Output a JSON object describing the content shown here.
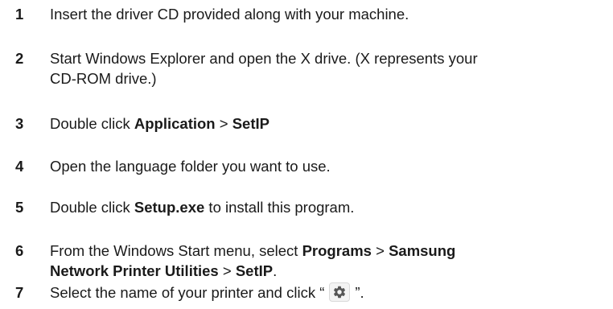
{
  "steps": [
    {
      "number": "1",
      "text_1": "Insert the driver CD provided along with your machine."
    },
    {
      "number": "2",
      "line_1": "Start Windows Explorer and open the X drive. (X represents your",
      "line_2": "CD-ROM drive.)"
    },
    {
      "number": "3",
      "text_1": "Double click ",
      "bold_1": "Application",
      "text_2": " > ",
      "bold_2": "SetIP"
    },
    {
      "number": "4",
      "text_1": "Open the language folder you want to use."
    },
    {
      "number": "5",
      "text_1": "Double click ",
      "bold_1": "Setup.exe",
      "text_2": " to install this program."
    },
    {
      "number": "6",
      "text_1": "From the Windows Start menu, select ",
      "bold_1": "Programs",
      "text_2": " > ",
      "bold_2": "Samsung",
      "bold_3": "Network Printer Utilities",
      "text_3": " > ",
      "bold_4": "SetIP",
      "text_4": "."
    },
    {
      "number": "7",
      "text_1": "Select the name of your printer and click “",
      "icon": "gear-icon",
      "text_2": "”."
    }
  ]
}
